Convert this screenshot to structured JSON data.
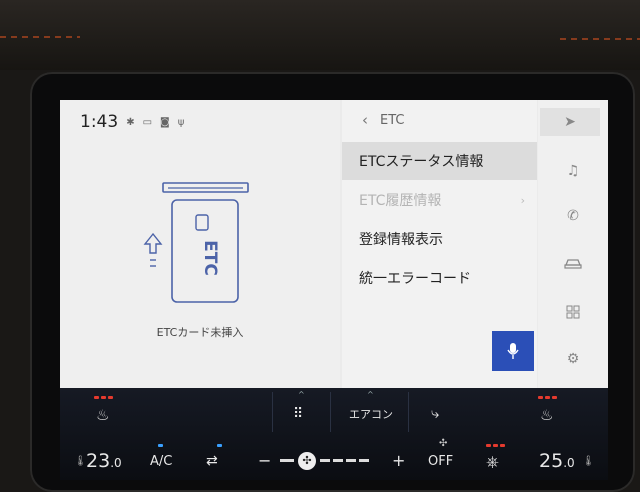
{
  "status": {
    "time": "1:43"
  },
  "etc_panel": {
    "card_text": "ETC",
    "caption": "ETCカード未挿入"
  },
  "etc_menu": {
    "back_icon": "chevron-left-icon",
    "title": "ETC",
    "items": [
      {
        "label": "ETCステータス情報",
        "selected": true,
        "enabled": true
      },
      {
        "label": "ETC履歴情報",
        "selected": false,
        "enabled": false
      },
      {
        "label": "登録情報表示",
        "selected": false,
        "enabled": true
      },
      {
        "label": "統一エラーコード",
        "selected": false,
        "enabled": true
      }
    ],
    "voice_button_icon": "microphone-icon"
  },
  "rail": {
    "icons": [
      "navigation-icon",
      "music-icon",
      "phone-icon",
      "car-icon",
      "apps-grid-icon",
      "settings-gear-icon"
    ]
  },
  "climate": {
    "aircon_label": "エアコン",
    "left_temp": "23",
    "left_temp_decimal": ".0",
    "right_temp": "25",
    "right_temp_decimal": ".0",
    "ac_label": "A/C",
    "minus": "−",
    "plus": "+",
    "off_label": "OFF",
    "fan_level": 0.3
  },
  "colors": {
    "accent_blue": "#2b4fb7",
    "heat_red": "#e53a2e",
    "climate_bg": "#0f1219"
  }
}
